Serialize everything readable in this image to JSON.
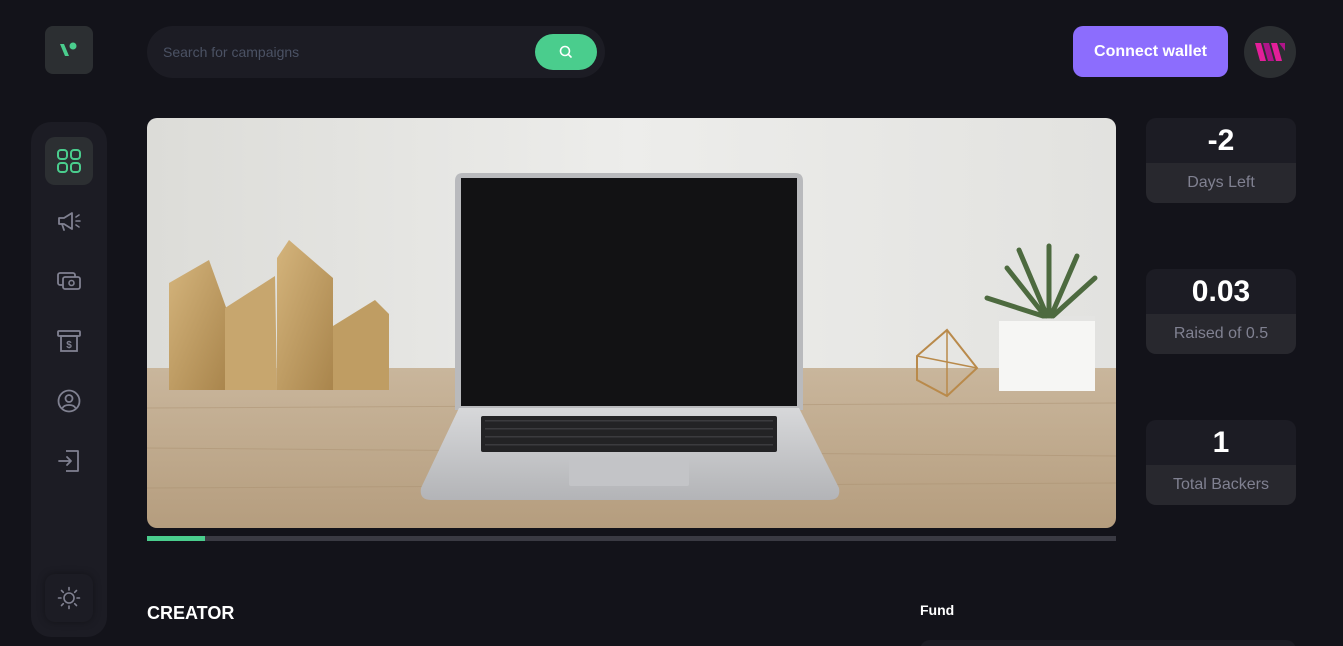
{
  "header": {
    "search": {
      "placeholder": "Search for campaigns"
    },
    "connect_label": "Connect wallet"
  },
  "sidebar": {
    "items": [
      {
        "name": "dashboard",
        "icon": "dashboard-icon",
        "active": true
      },
      {
        "name": "campaign",
        "icon": "megaphone-icon"
      },
      {
        "name": "payment",
        "icon": "payment-icon"
      },
      {
        "name": "withdraw",
        "icon": "withdraw-icon"
      },
      {
        "name": "profile",
        "icon": "profile-icon"
      },
      {
        "name": "logout",
        "icon": "logout-icon"
      }
    ],
    "theme_icon": "sun-icon"
  },
  "campaign": {
    "progress_fraction": 0.06,
    "stats": [
      {
        "value": "-2",
        "label": "Days Left"
      },
      {
        "value": "0.03",
        "label": "Raised of 0.5"
      },
      {
        "value": "1",
        "label": "Total Backers"
      }
    ],
    "creator_heading": "CREATOR",
    "fund_heading": "Fund"
  },
  "colors": {
    "accent_green": "#4acd8d",
    "accent_purple": "#8c6dfd",
    "background": "#13131a",
    "panel": "#1c1c24"
  }
}
